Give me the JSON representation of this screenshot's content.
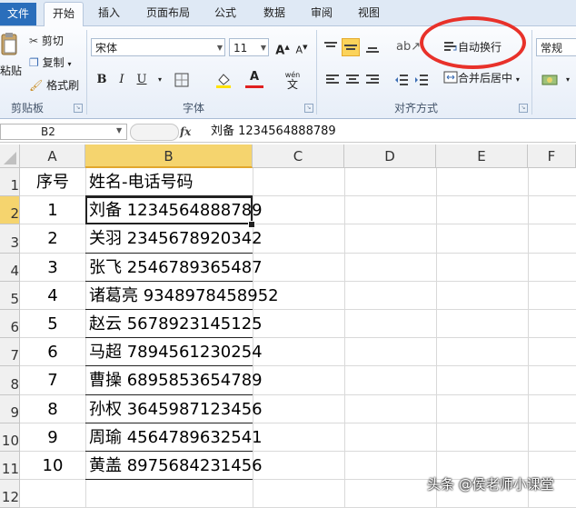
{
  "tabs": [
    "文件",
    "开始",
    "插入",
    "页面布局",
    "公式",
    "数据",
    "审阅",
    "视图"
  ],
  "clipboard": {
    "paste_label": "粘贴",
    "cut_label": "剪切",
    "copy_label": "复制",
    "format_painter_label": "格式刷",
    "group_label": "剪贴板"
  },
  "font": {
    "font_name": "宋体",
    "font_size": "11",
    "bold": "B",
    "italic": "I",
    "underline": "U",
    "font_color_glyph": "A",
    "phonetic_glyph": "wén",
    "group_label": "字体"
  },
  "alignment": {
    "wrap_text_label": "自动换行",
    "merge_center_label": "合并后居中",
    "group_label": "对齐方式"
  },
  "number": {
    "format_value": "常规"
  },
  "formula_bar": {
    "name_box": "B2",
    "fx": "fx",
    "content": "刘备 1234564888789"
  },
  "columns": [
    "A",
    "B",
    "C",
    "D",
    "E",
    "F"
  ],
  "row_numbers": [
    "1",
    "2",
    "3",
    "4",
    "5",
    "6",
    "7",
    "8",
    "9",
    "10",
    "11",
    "12"
  ],
  "rows": [
    {
      "a": "序号",
      "b": "姓名-电话号码"
    },
    {
      "a": "1",
      "b": "刘备 1234564888789"
    },
    {
      "a": "2",
      "b": "关羽 2345678920342"
    },
    {
      "a": "3",
      "b": "张飞 2546789365487"
    },
    {
      "a": "4",
      "b": "诸葛亮 9348978458952"
    },
    {
      "a": "5",
      "b": "赵云 5678923145125"
    },
    {
      "a": "6",
      "b": "马超 7894561230254"
    },
    {
      "a": "7",
      "b": "曹操 6895853654789"
    },
    {
      "a": "8",
      "b": "孙权 3645987123456"
    },
    {
      "a": "9",
      "b": "周瑜 4564789632541"
    },
    {
      "a": "10",
      "b": "黄盖 8975684231456"
    }
  ],
  "watermark": "头条 @侯老师小课堂",
  "colors": {
    "accent": "#2a6ebb",
    "highlight": "#e8312a",
    "selected_header": "#f5d46e"
  }
}
